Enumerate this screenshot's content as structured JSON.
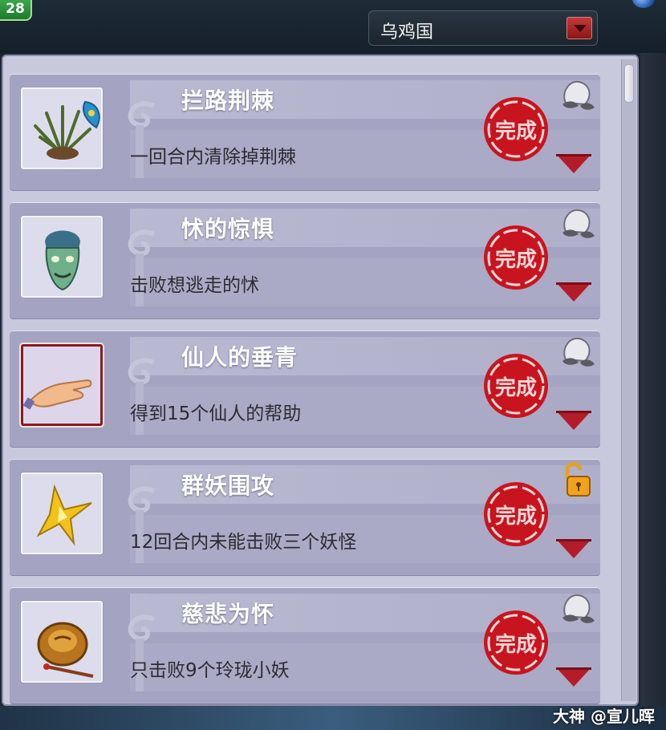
{
  "top_bar": {
    "level": "28",
    "region_select": {
      "value": "乌鸡国"
    }
  },
  "colors": {
    "panel_bg": "#c9c9de",
    "card_bg": "#a4a4c2",
    "title_text": "#ffffff",
    "desc_text": "#2b2b34",
    "stamp_red": "#c8141e",
    "arrow_red": "#b41c2a"
  },
  "achievements": [
    {
      "title": "拦路荆棘",
      "description": "一回合内清除掉荆棘",
      "status": "完成",
      "reward_icon": "peach-icon",
      "icon": "thorn-plant-icon"
    },
    {
      "title": "怵的惊惧",
      "description": "击败想逃走的怵",
      "status": "完成",
      "reward_icon": "peach-icon",
      "icon": "ghost-head-icon"
    },
    {
      "title": "仙人的垂青",
      "description": "得到15个仙人的帮助",
      "status": "完成",
      "reward_icon": "peach-icon",
      "icon": "open-hand-icon"
    },
    {
      "title": "群妖围攻",
      "description": "12回合内未能击败三个妖怪",
      "status": "完成",
      "reward_icon": "padlock-icon",
      "icon": "golden-star-icon"
    },
    {
      "title": "慈悲为怀",
      "description": "只击败9个玲珑小妖",
      "status": "完成",
      "reward_icon": "peach-icon",
      "icon": "bronze-bell-icon"
    }
  ],
  "watermark": "大神 @宣儿晖"
}
